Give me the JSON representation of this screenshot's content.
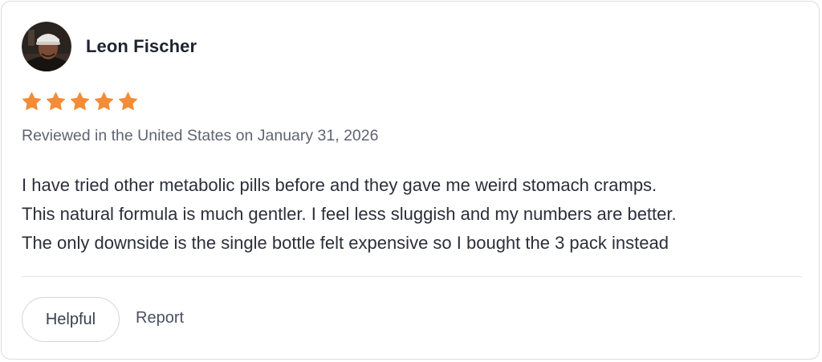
{
  "review": {
    "author": "Leon Fischer",
    "rating": 5,
    "rating_max": 5,
    "star_color": "#f28c38",
    "meta": "Reviewed in the United States on January 31, 2026",
    "body_lines": [
      "I have tried other metabolic pills before and they gave me weird stomach cramps.",
      "This natural formula is much gentler. I feel less sluggish and my numbers are better.",
      "The only downside is the single bottle felt expensive so I bought the 3 pack instead"
    ]
  },
  "actions": {
    "helpful_label": "Helpful",
    "report_label": "Report"
  }
}
